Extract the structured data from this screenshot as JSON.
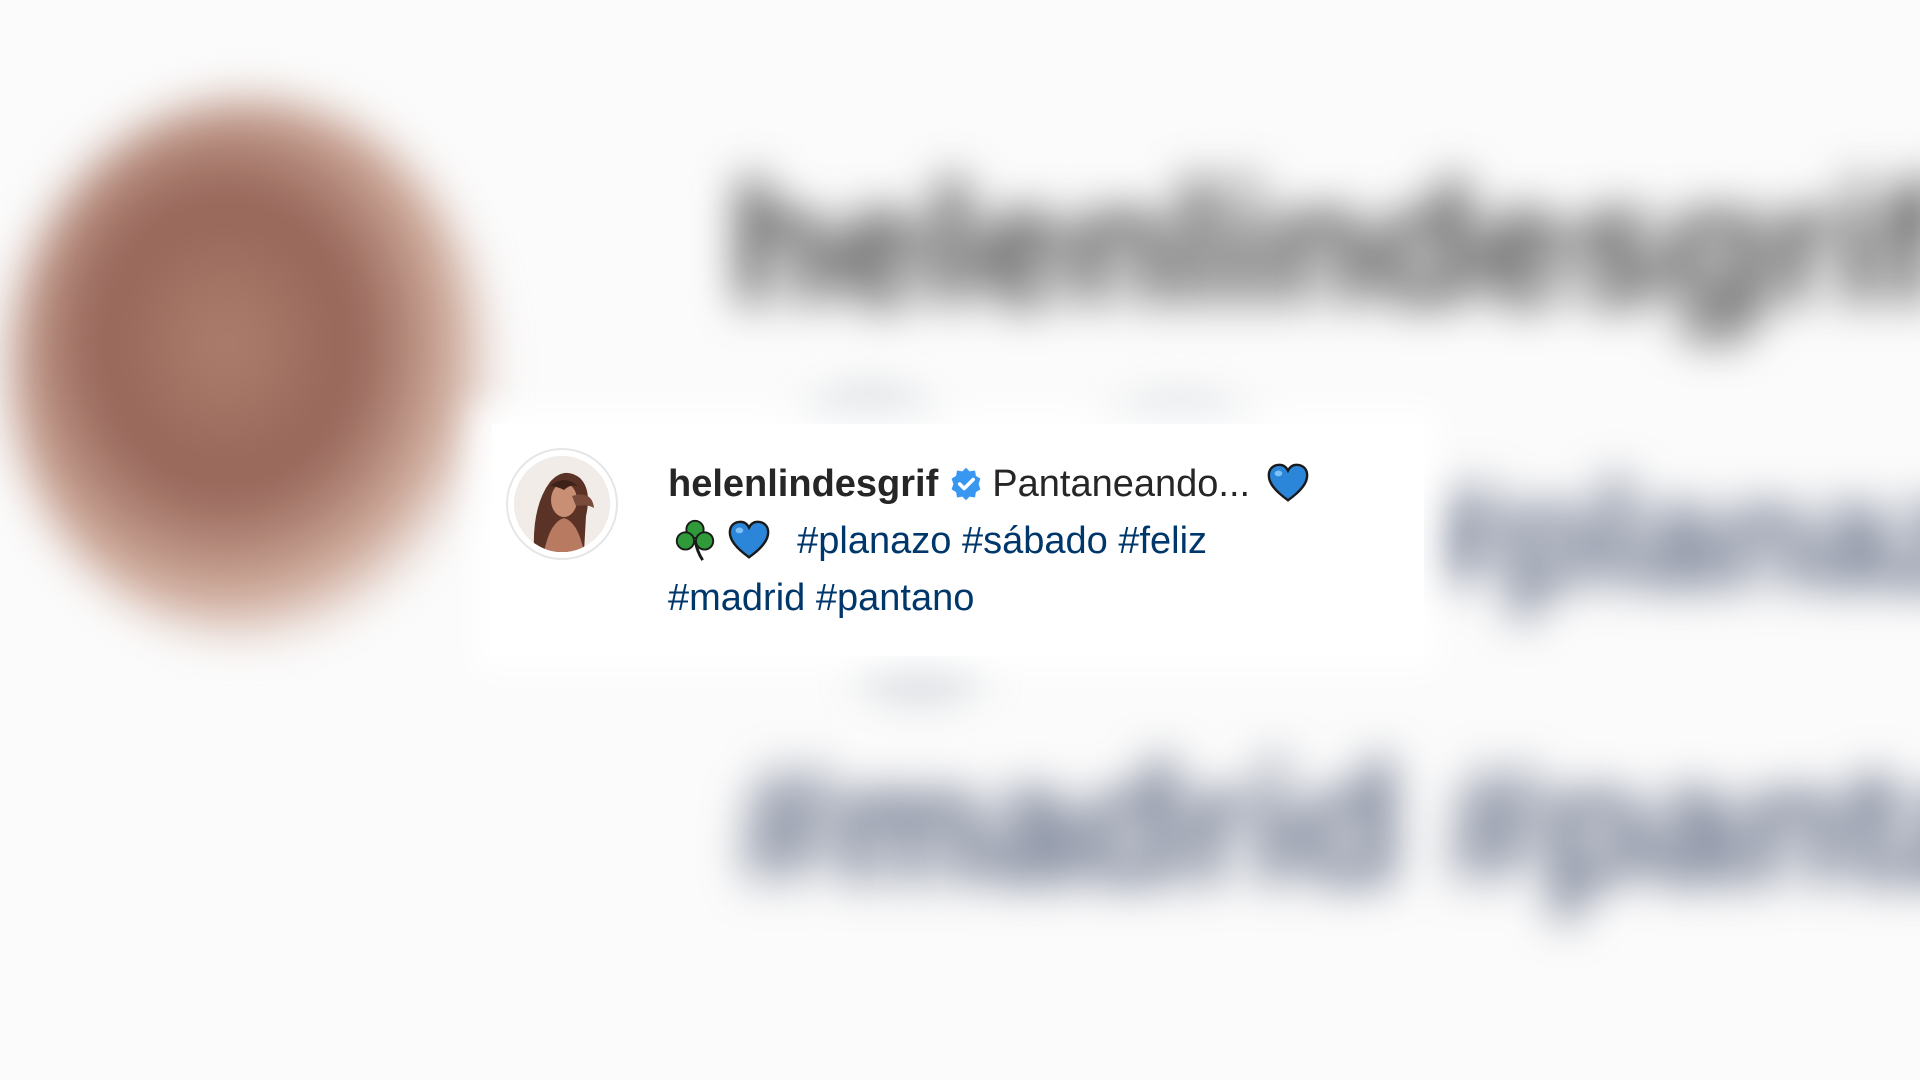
{
  "post": {
    "username": "helenlindesgrif",
    "caption_text": "Pantaneando...",
    "hashtags": [
      "#planazo",
      "#sábado",
      "#feliz",
      "#madrid",
      "#pantano"
    ],
    "icons": {
      "verified": "verified-badge-icon",
      "heart": "blue-heart-icon",
      "shamrock": "shamrock-icon"
    },
    "colors": {
      "username": "#262626",
      "hashtag": "#00376b",
      "verified": "#3897f0",
      "heart": "#2b86d9",
      "shamrock": "#2e9a3a"
    }
  }
}
